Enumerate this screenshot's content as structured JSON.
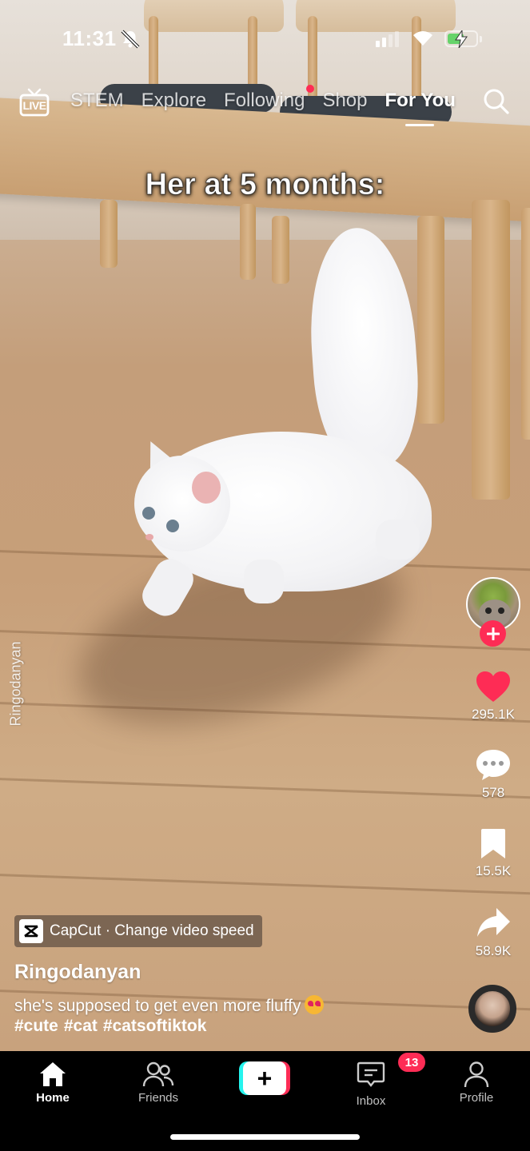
{
  "status_bar": {
    "time": "11:31",
    "battery_level": 0.6,
    "battery_color": "#66d36a"
  },
  "top_nav": {
    "live_label": "LIVE",
    "tabs": [
      {
        "label": "STEM",
        "active": false
      },
      {
        "label": "Explore",
        "active": false
      },
      {
        "label": "Following",
        "active": false,
        "has_notification_dot": true
      },
      {
        "label": "Shop",
        "active": false
      },
      {
        "label": "For You",
        "active": true
      }
    ],
    "search_icon": "search-icon"
  },
  "video": {
    "caption": "Her at 5 months:",
    "watermark": "Ringodanyan"
  },
  "actions": {
    "likes": "295.1K",
    "comments": "578",
    "bookmarks": "15.5K",
    "shares": "58.9K",
    "like_color": "#fe2c55"
  },
  "post": {
    "capcut_label": "CapCut · Change video speed",
    "username": "Ringodanyan",
    "description": "she's supposed to get even more fluffy",
    "hashtags": [
      "#cute",
      "#cat",
      "#catsoftiktok"
    ]
  },
  "bottom_nav": {
    "items": [
      {
        "label": "Home",
        "icon": "home-icon",
        "active": true
      },
      {
        "label": "Friends",
        "icon": "friends-icon",
        "active": false
      },
      {
        "label": "",
        "icon": "create-icon",
        "active": false
      },
      {
        "label": "Inbox",
        "icon": "inbox-icon",
        "active": false,
        "badge": "13"
      },
      {
        "label": "Profile",
        "icon": "profile-icon",
        "active": false
      }
    ],
    "create_symbol": "+"
  },
  "colors": {
    "accent_red": "#fe2c55",
    "accent_cyan": "#25f4ee"
  }
}
